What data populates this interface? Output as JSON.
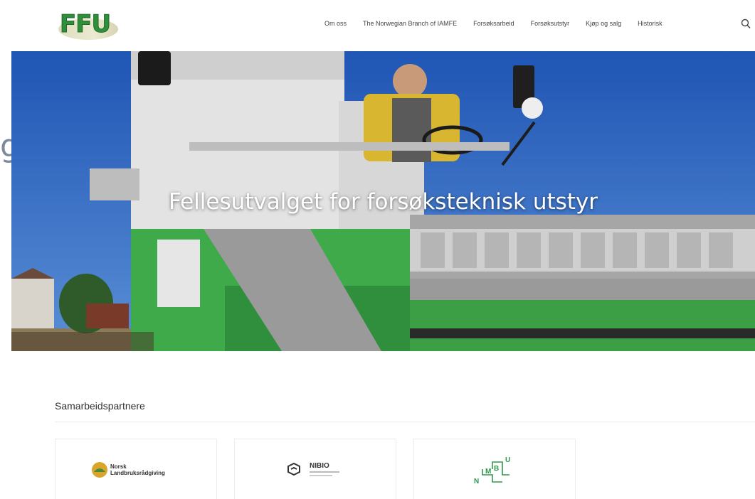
{
  "side_glyph": "g",
  "header": {
    "logo_text": "FFU",
    "nav": [
      "Om oss",
      "The Norwegian Branch of IAMFE",
      "Forsøksarbeid",
      "Forsøksutstyr",
      "Kjøp og salg",
      "Historisk"
    ],
    "search_icon": "search-icon"
  },
  "hero": {
    "title": "Fellesutvalget for forsøksteknisk utstyr"
  },
  "partners": {
    "heading": "Samarbeidspartnere",
    "items": [
      {
        "line1": "Norsk",
        "line2": "Landbruksrådgiving",
        "icon": "nlr-logo-icon"
      },
      {
        "name": "NIBIO",
        "icon": "nibio-logo-icon"
      },
      {
        "letters": [
          "N",
          "M",
          "B",
          "U"
        ],
        "icon": "nmbu-logo-icon"
      }
    ]
  },
  "colors": {
    "brand_green": "#2f8f3a",
    "sky_blue": "#2a5db7",
    "machine_green": "#3faa4a"
  }
}
